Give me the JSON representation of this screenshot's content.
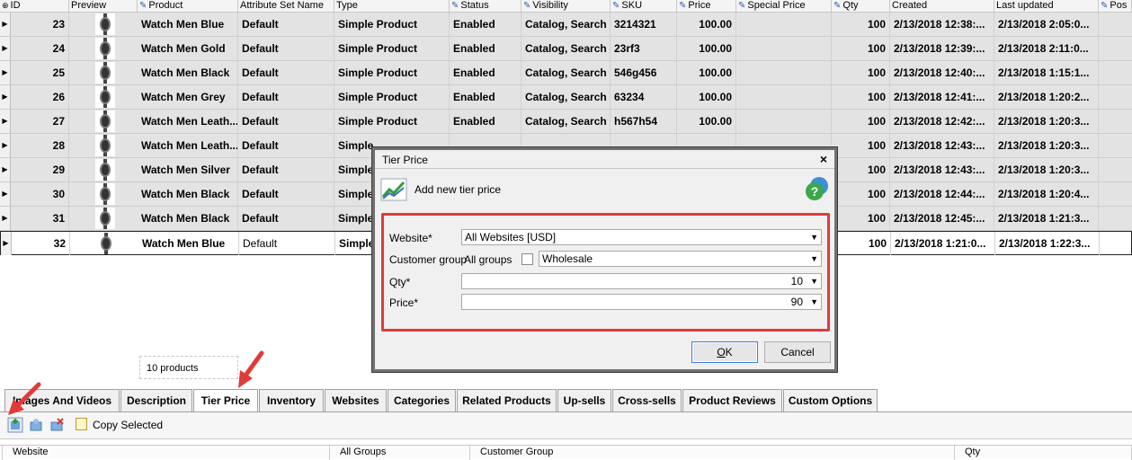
{
  "columns": [
    {
      "label": "ID",
      "edit": false,
      "marker": "⊕"
    },
    {
      "label": "Preview",
      "edit": false
    },
    {
      "label": "Product",
      "edit": true
    },
    {
      "label": "Attribute Set Name",
      "edit": false
    },
    {
      "label": "Type",
      "edit": false
    },
    {
      "label": "Status",
      "edit": true
    },
    {
      "label": "Visibility",
      "edit": true
    },
    {
      "label": "SKU",
      "edit": true
    },
    {
      "label": "Price",
      "edit": true
    },
    {
      "label": "Special Price",
      "edit": true
    },
    {
      "label": "Qty",
      "edit": true
    },
    {
      "label": "Created",
      "edit": false
    },
    {
      "label": "Last updated",
      "edit": false
    },
    {
      "label": "Pos",
      "edit": true
    }
  ],
  "rows": [
    {
      "id": "23",
      "product": "Watch Men Blue",
      "attr_set": "Default",
      "type": "Simple Product",
      "status": "Enabled",
      "visibility": "Catalog, Search",
      "sku": "3214321",
      "price": "100.00",
      "special_price": "",
      "qty": "100",
      "created": "2/13/2018 12:38:...",
      "updated": "2/13/2018 2:05:0..."
    },
    {
      "id": "24",
      "product": "Watch Men Gold",
      "attr_set": "Default",
      "type": "Simple Product",
      "status": "Enabled",
      "visibility": "Catalog, Search",
      "sku": "23rf3",
      "price": "100.00",
      "special_price": "",
      "qty": "100",
      "created": "2/13/2018 12:39:...",
      "updated": "2/13/2018 2:11:0..."
    },
    {
      "id": "25",
      "product": "Watch Men Black",
      "attr_set": "Default",
      "type": "Simple Product",
      "status": "Enabled",
      "visibility": "Catalog, Search",
      "sku": "546g456",
      "price": "100.00",
      "special_price": "",
      "qty": "100",
      "created": "2/13/2018 12:40:...",
      "updated": "2/13/2018 1:15:1..."
    },
    {
      "id": "26",
      "product": "Watch Men Grey",
      "attr_set": "Default",
      "type": "Simple Product",
      "status": "Enabled",
      "visibility": "Catalog, Search",
      "sku": "63234",
      "price": "100.00",
      "special_price": "",
      "qty": "100",
      "created": "2/13/2018 12:41:...",
      "updated": "2/13/2018 1:20:2..."
    },
    {
      "id": "27",
      "product": "Watch Men Leath...",
      "attr_set": "Default",
      "type": "Simple Product",
      "status": "Enabled",
      "visibility": "Catalog, Search",
      "sku": "h567h54",
      "price": "100.00",
      "special_price": "",
      "qty": "100",
      "created": "2/13/2018 12:42:...",
      "updated": "2/13/2018 1:20:3..."
    },
    {
      "id": "28",
      "product": "Watch Men Leath...",
      "attr_set": "Default",
      "type": "Simple",
      "status": "",
      "visibility": "",
      "sku": "",
      "price": "",
      "special_price": "",
      "qty": "100",
      "created": "2/13/2018 12:43:...",
      "updated": "2/13/2018 1:20:3..."
    },
    {
      "id": "29",
      "product": "Watch Men Silver",
      "attr_set": "Default",
      "type": "Simple",
      "status": "",
      "visibility": "",
      "sku": "",
      "price": "",
      "special_price": "",
      "qty": "100",
      "created": "2/13/2018 12:43:...",
      "updated": "2/13/2018 1:20:3..."
    },
    {
      "id": "30",
      "product": "Watch Men Black",
      "attr_set": "Default",
      "type": "Simple",
      "status": "",
      "visibility": "",
      "sku": "",
      "price": "",
      "special_price": "",
      "qty": "100",
      "created": "2/13/2018 12:44:...",
      "updated": "2/13/2018 1:20:4..."
    },
    {
      "id": "31",
      "product": "Watch Men Black",
      "attr_set": "Default",
      "type": "Simple",
      "status": "",
      "visibility": "",
      "sku": "",
      "price": "",
      "special_price": "",
      "qty": "100",
      "created": "2/13/2018 12:45:...",
      "updated": "2/13/2018 1:21:3..."
    },
    {
      "id": "32",
      "product": "Watch Men Blue",
      "attr_set": "Default",
      "type": "Simple",
      "status": "",
      "visibility": "",
      "sku": "",
      "price": "",
      "special_price": "",
      "qty": "100",
      "created": "2/13/2018 1:21:0...",
      "updated": "2/13/2018 1:22:3..."
    }
  ],
  "footer": {
    "count": "10 products"
  },
  "tabs": [
    "Images And Videos",
    "Description",
    "Tier Price",
    "Inventory",
    "Websites",
    "Categories",
    "Related Products",
    "Up-sells",
    "Cross-sells",
    "Product Reviews",
    "Custom Options"
  ],
  "active_tab": "Tier Price",
  "toolbar": {
    "copy_selected": "Copy Selected"
  },
  "tier_grid_columns": [
    "Website",
    "All Groups",
    "Customer Group",
    "Qty"
  ],
  "dialog": {
    "title": "Tier Price",
    "close": "×",
    "heading": "Add new tier price",
    "website_label": "Website*",
    "website_value": "All Websites [USD]",
    "group_label": "Customer group",
    "all_groups_label": "All groups",
    "all_groups_checked": false,
    "group_value": "Wholesale",
    "qty_label": "Qty*",
    "qty_value": "10",
    "price_label": "Price*",
    "price_value": "90",
    "ok_prefix": "",
    "ok_underlined": "O",
    "ok_suffix": "K",
    "cancel": "Cancel"
  },
  "colors": {
    "annotation": "#e03a3a",
    "row_bg": "#e3e3e3",
    "edit_pencil": "#2a5db0"
  }
}
